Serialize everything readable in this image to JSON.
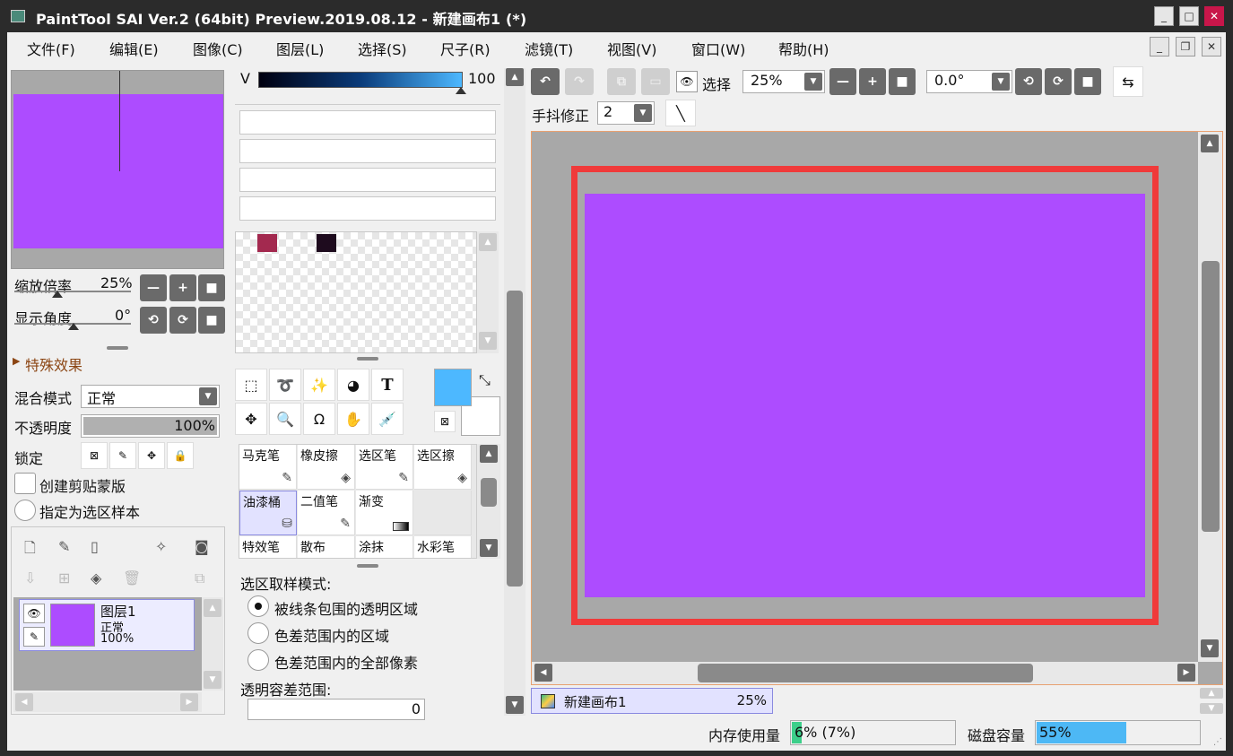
{
  "window": {
    "title": "PaintTool SAI Ver.2 (64bit) Preview.2019.08.12 - 新建画布1 (*)",
    "controls": {
      "minimize": "_",
      "maximize": "□",
      "close": "✕"
    }
  },
  "menu": {
    "items": [
      "文件(F)",
      "编辑(E)",
      "图像(C)",
      "图层(L)",
      "选择(S)",
      "尺子(R)",
      "滤镜(T)",
      "视图(V)",
      "窗口(W)",
      "帮助(H)"
    ],
    "mdi_controls": {
      "minimize": "_",
      "restore": "❐",
      "close": "✕"
    }
  },
  "navigator": {
    "zoom_label": "缩放倍率",
    "zoom_value": "25%",
    "angle_label": "显示角度",
    "angle_value": "0°",
    "preview_color": "#ad4cff"
  },
  "layer_props": {
    "effects_label": "特殊效果",
    "blend_label": "混合模式",
    "blend_value": "正常",
    "opacity_label": "不透明度",
    "opacity_value": "100%",
    "lock_label": "锁定",
    "clip_label": "创建剪贴蒙版",
    "sample_label": "指定为选区样本"
  },
  "layers": [
    {
      "name": "图层1",
      "mode": "正常",
      "opacity": "100%",
      "color": "#ad4cff"
    }
  ],
  "color": {
    "channel_label": "V",
    "channel_value": "100",
    "swatches": [
      "#a3294f",
      "#1e0b1e"
    ],
    "primary": "#4db8ff",
    "secondary": "#ffffff"
  },
  "brushes": [
    {
      "label": "马克笔",
      "icon": "✎",
      "selected": false
    },
    {
      "label": "橡皮擦",
      "icon": "◈",
      "selected": false
    },
    {
      "label": "选区笔",
      "icon": "✎",
      "selected": false
    },
    {
      "label": "选区擦",
      "icon": "◈",
      "selected": false
    },
    {
      "label": "油漆桶",
      "icon": "⛁",
      "selected": true
    },
    {
      "label": "二值笔",
      "icon": "✎",
      "selected": false
    },
    {
      "label": "渐变",
      "icon": "▬",
      "selected": false
    },
    {
      "label": "",
      "icon": "",
      "selected": false
    },
    {
      "label": "特效笔",
      "icon": "",
      "selected": false
    },
    {
      "label": "散布",
      "icon": "",
      "selected": false
    },
    {
      "label": "涂抹",
      "icon": "",
      "selected": false
    },
    {
      "label": "水彩笔",
      "icon": "",
      "selected": false
    }
  ],
  "fill_options": {
    "mode_label": "选区取样模式:",
    "options": [
      "被线条包围的透明区域",
      "色差范围内的区域",
      "色差范围内的全部像素"
    ],
    "selected_index": 0,
    "tolerance_label": "透明容差范围:",
    "tolerance_value": "0"
  },
  "toolbar": {
    "select_label": "选择",
    "zoom_value": "25%",
    "angle_value": "0.0°",
    "stabilizer_label": "手抖修正",
    "stabilizer_value": "2"
  },
  "canvas": {
    "fill_color": "#ad4cff",
    "highlight_color": "#f03a3a"
  },
  "doc_tab": {
    "name": "新建画布1",
    "zoom": "25%"
  },
  "status": {
    "memory_label": "内存使用量",
    "memory_value": "6% (7%)",
    "memory_fraction": 0.06,
    "disk_label": "磁盘容量",
    "disk_value": "55%",
    "disk_fraction": 0.55
  }
}
